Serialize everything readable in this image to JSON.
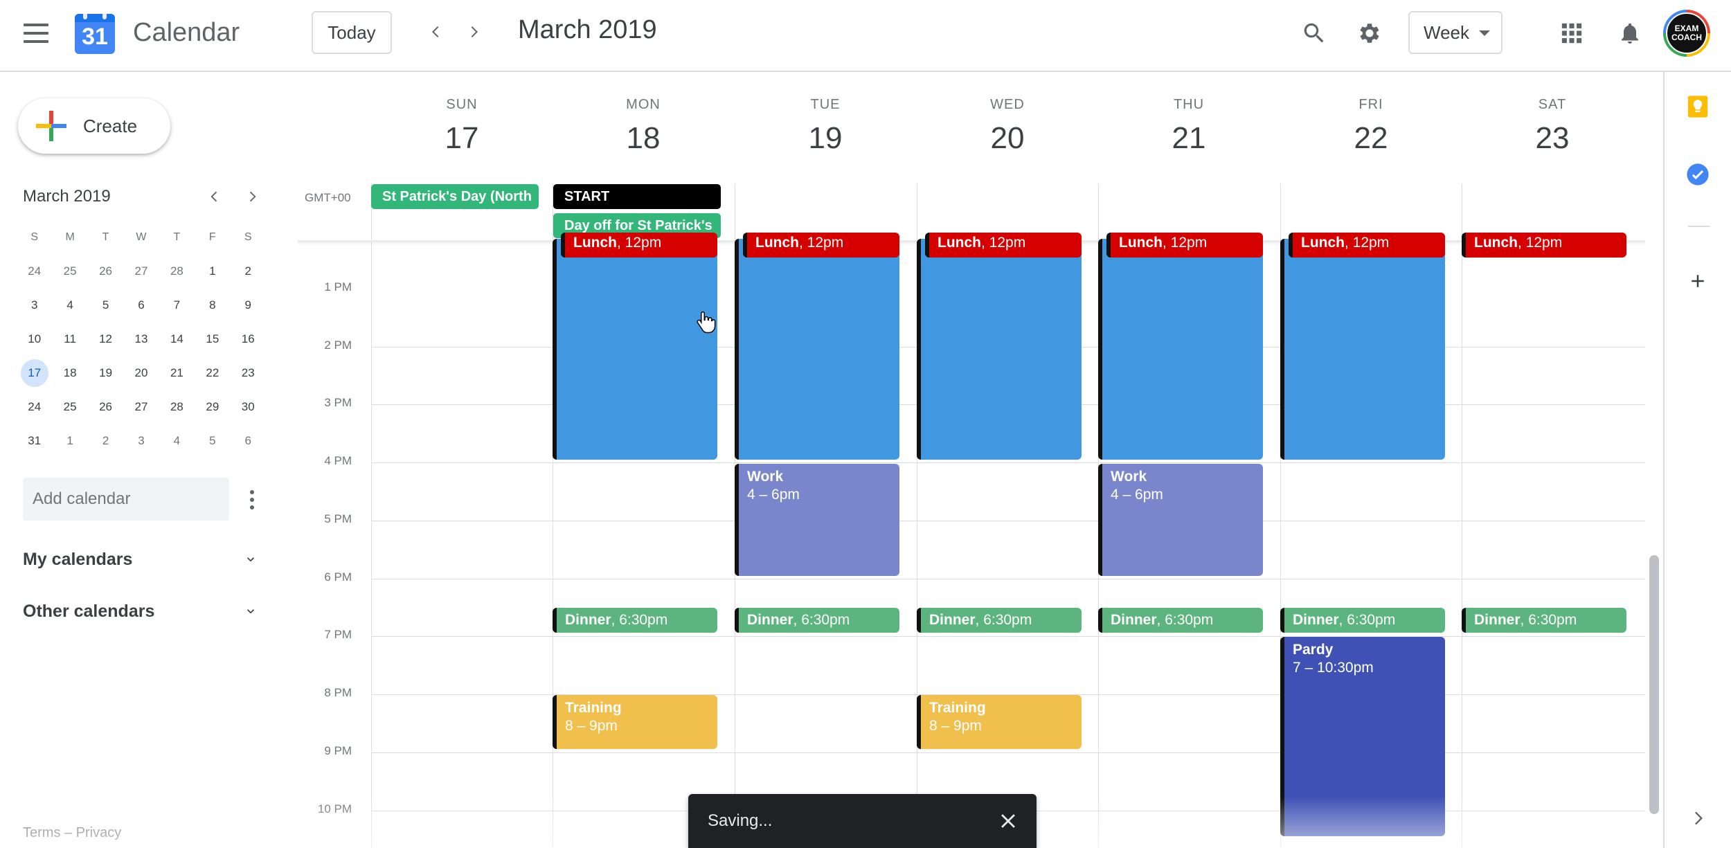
{
  "header": {
    "app_title": "Calendar",
    "logo_number": "31",
    "today_label": "Today",
    "month_title": "March 2019",
    "view_label": "Week",
    "avatar_text": "EXAM COACH"
  },
  "sidebar": {
    "create_label": "Create",
    "mini_month_title": "March 2019",
    "weekday_initials": [
      "S",
      "M",
      "T",
      "W",
      "T",
      "F",
      "S"
    ],
    "weeks": [
      [
        "24",
        "25",
        "26",
        "27",
        "28",
        "1",
        "2"
      ],
      [
        "3",
        "4",
        "5",
        "6",
        "7",
        "8",
        "9"
      ],
      [
        "10",
        "11",
        "12",
        "13",
        "14",
        "15",
        "16"
      ],
      [
        "17",
        "18",
        "19",
        "20",
        "21",
        "22",
        "23"
      ],
      [
        "24",
        "25",
        "26",
        "27",
        "28",
        "29",
        "30"
      ],
      [
        "31",
        "1",
        "2",
        "3",
        "4",
        "5",
        "6"
      ]
    ],
    "add_calendar_placeholder": "Add calendar",
    "my_calendars_label": "My calendars",
    "other_calendars_label": "Other calendars",
    "footer": "Terms – Privacy"
  },
  "week": {
    "timezone": "GMT+00",
    "days": [
      {
        "dow": "SUN",
        "num": "17"
      },
      {
        "dow": "MON",
        "num": "18"
      },
      {
        "dow": "TUE",
        "num": "19"
      },
      {
        "dow": "WED",
        "num": "20"
      },
      {
        "dow": "THU",
        "num": "21"
      },
      {
        "dow": "FRI",
        "num": "22"
      },
      {
        "dow": "SAT",
        "num": "23"
      }
    ],
    "hours": [
      "1 PM",
      "2 PM",
      "3 PM",
      "4 PM",
      "5 PM",
      "6 PM",
      "7 PM",
      "8 PM",
      "9 PM",
      "10 PM"
    ]
  },
  "all_day_events": [
    {
      "title": "St Patrick's Day (North",
      "day": 0,
      "row": 0,
      "color": "#33b679"
    },
    {
      "title": "START",
      "day": 1,
      "row": 0,
      "color": "#000000"
    },
    {
      "title": "Day off for St Patrick's",
      "day": 1,
      "row": 1,
      "color": "#33b679"
    }
  ],
  "events": [
    {
      "title": "Lunch",
      "time": "12pm",
      "day": 1,
      "color": "#d50000"
    },
    {
      "title": "Lunch",
      "time": "12pm",
      "day": 2,
      "color": "#d50000"
    },
    {
      "title": "Lunch",
      "time": "12pm",
      "day": 3,
      "color": "#d50000"
    },
    {
      "title": "Lunch",
      "time": "12pm",
      "day": 4,
      "color": "#d50000"
    },
    {
      "title": "Lunch",
      "time": "12pm",
      "day": 5,
      "color": "#d50000"
    },
    {
      "title": "Lunch",
      "time": "12pm",
      "day": 6,
      "color": "#d50000"
    },
    {
      "title": "",
      "time": "",
      "day": 1,
      "color": "#4198e1"
    },
    {
      "title": "",
      "time": "",
      "day": 2,
      "color": "#4198e1"
    },
    {
      "title": "",
      "time": "",
      "day": 3,
      "color": "#4198e1"
    },
    {
      "title": "",
      "time": "",
      "day": 4,
      "color": "#4198e1"
    },
    {
      "title": "",
      "time": "",
      "day": 5,
      "color": "#4198e1"
    },
    {
      "title": "Work",
      "time": "4 – 6pm",
      "day": 2,
      "color": "#7986cb"
    },
    {
      "title": "Work",
      "time": "4 – 6pm",
      "day": 4,
      "color": "#7986cb"
    },
    {
      "title": "Dinner",
      "time": "6:30pm",
      "day": 1,
      "color": "#5cb57e"
    },
    {
      "title": "Dinner",
      "time": "6:30pm",
      "day": 2,
      "color": "#5cb57e"
    },
    {
      "title": "Dinner",
      "time": "6:30pm",
      "day": 3,
      "color": "#5cb57e"
    },
    {
      "title": "Dinner",
      "time": "6:30pm",
      "day": 4,
      "color": "#5cb57e"
    },
    {
      "title": "Dinner",
      "time": "6:30pm",
      "day": 5,
      "color": "#5cb57e"
    },
    {
      "title": "Dinner",
      "time": "6:30pm",
      "day": 6,
      "color": "#5cb57e"
    },
    {
      "title": "Pardy",
      "time": "7 – 10:30pm",
      "day": 5,
      "color": "#3f51b5"
    },
    {
      "title": "Training",
      "time": "8 – 9pm",
      "day": 1,
      "color": "#f0bf4c"
    },
    {
      "title": "Training",
      "time": "8 – 9pm",
      "day": 3,
      "color": "#f0bf4c"
    }
  ],
  "toast": {
    "message": "Saving..."
  }
}
